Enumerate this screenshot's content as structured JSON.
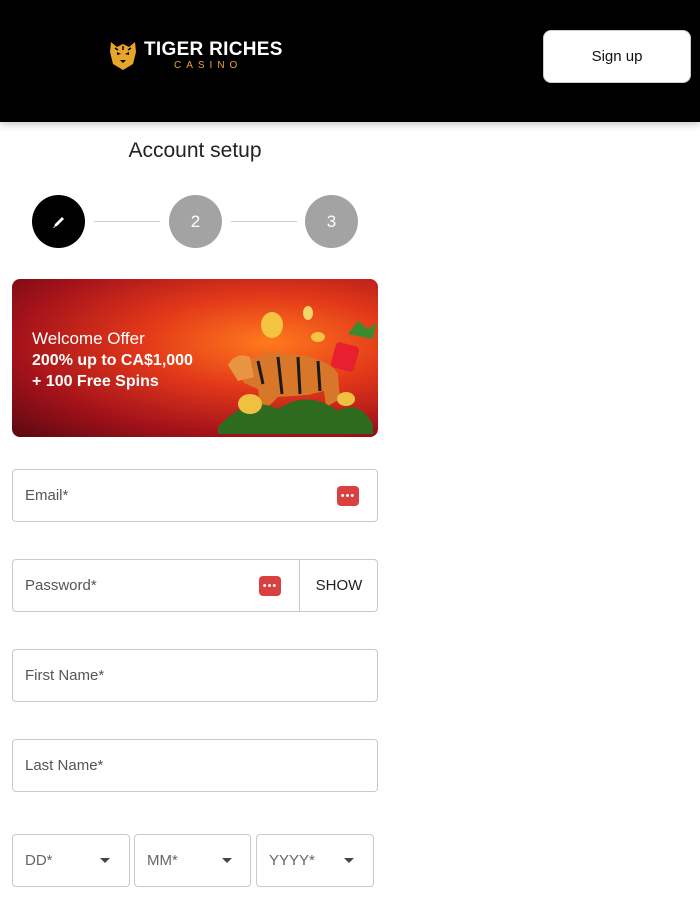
{
  "brand": {
    "name": "TIGER RICHES",
    "sub": "CASINO"
  },
  "header": {
    "signup_label": "Sign up"
  },
  "page": {
    "title": "Account setup"
  },
  "steps": [
    {
      "label": ""
    },
    {
      "label": "2"
    },
    {
      "label": "3"
    }
  ],
  "banner": {
    "line1": "Welcome Offer",
    "line2": "200% up to CA$1,000",
    "line3": "+ 100 Free Spins"
  },
  "form": {
    "email_placeholder": "Email*",
    "password_placeholder": "Password*",
    "show_label": "SHOW",
    "first_name_placeholder": "First Name*",
    "last_name_placeholder": "Last Name*",
    "dob": {
      "day": "DD*",
      "month": "MM*",
      "year": "YYYY*"
    }
  },
  "colors": {
    "header_bg": "#000000",
    "accent_orange": "#e7a52a",
    "step_active": "#000000",
    "step_inactive": "#a3a3a3",
    "password_manager_icon": "#d94040"
  },
  "icons": {
    "step1": "pencil-icon",
    "field": "password-manager-icon",
    "caret": "chevron-down-icon"
  }
}
